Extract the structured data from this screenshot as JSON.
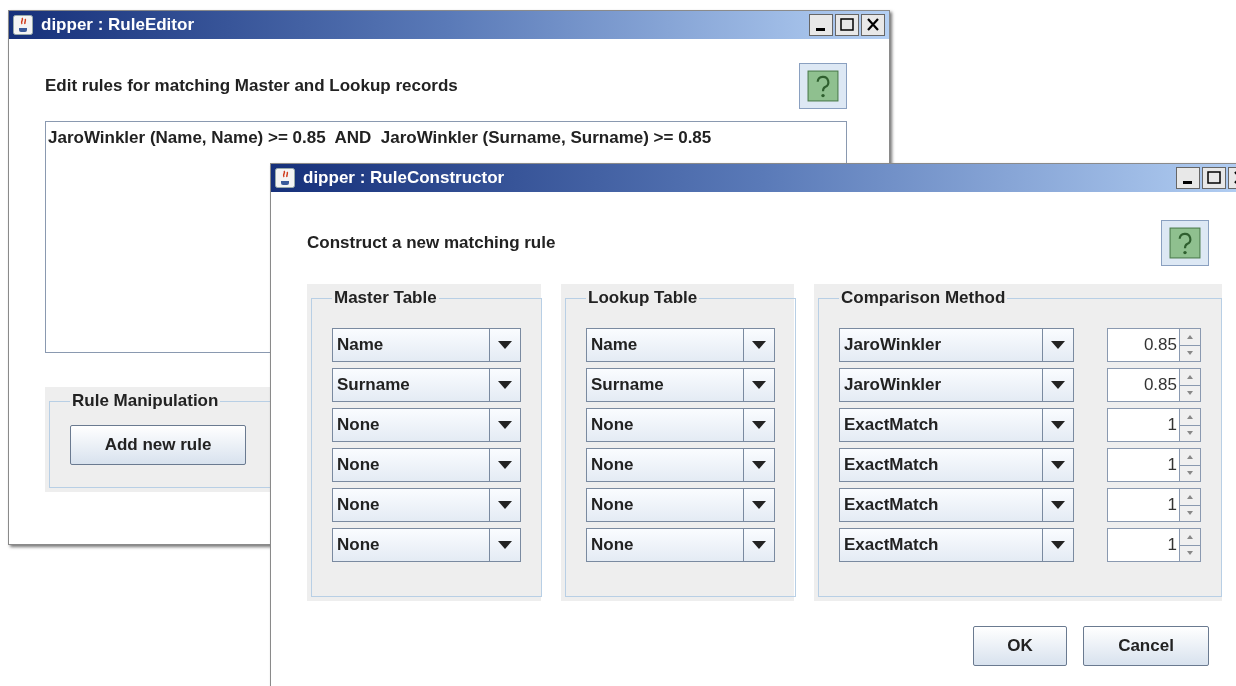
{
  "rule_editor": {
    "title": "dipper : RuleEditor",
    "heading": "Edit rules for matching Master and Lookup records",
    "rules_text": "JaroWinkler (Name, Name) >= 0.85  AND  JaroWinkler (Surname, Surname) >= 0.85",
    "group": {
      "title": "Rule Manipulation",
      "buttons": [
        "Add new rule"
      ]
    }
  },
  "rule_constructor": {
    "title": "dipper : RuleConstructor",
    "heading": "Construct a new matching rule",
    "master_table": {
      "title": "Master Table",
      "fields": [
        "Name",
        "Surname",
        "None",
        "None",
        "None",
        "None"
      ]
    },
    "lookup_table": {
      "title": "Lookup Table",
      "fields": [
        "Name",
        "Surname",
        "None",
        "None",
        "None",
        "None"
      ]
    },
    "comparison_method": {
      "title": "Comparison Method",
      "rows": [
        {
          "method": "JaroWinkler",
          "threshold": "0.85"
        },
        {
          "method": "JaroWinkler",
          "threshold": "0.85"
        },
        {
          "method": "ExactMatch",
          "threshold": "1"
        },
        {
          "method": "ExactMatch",
          "threshold": "1"
        },
        {
          "method": "ExactMatch",
          "threshold": "1"
        },
        {
          "method": "ExactMatch",
          "threshold": "1"
        }
      ]
    },
    "buttons": [
      "OK",
      "Cancel"
    ]
  }
}
